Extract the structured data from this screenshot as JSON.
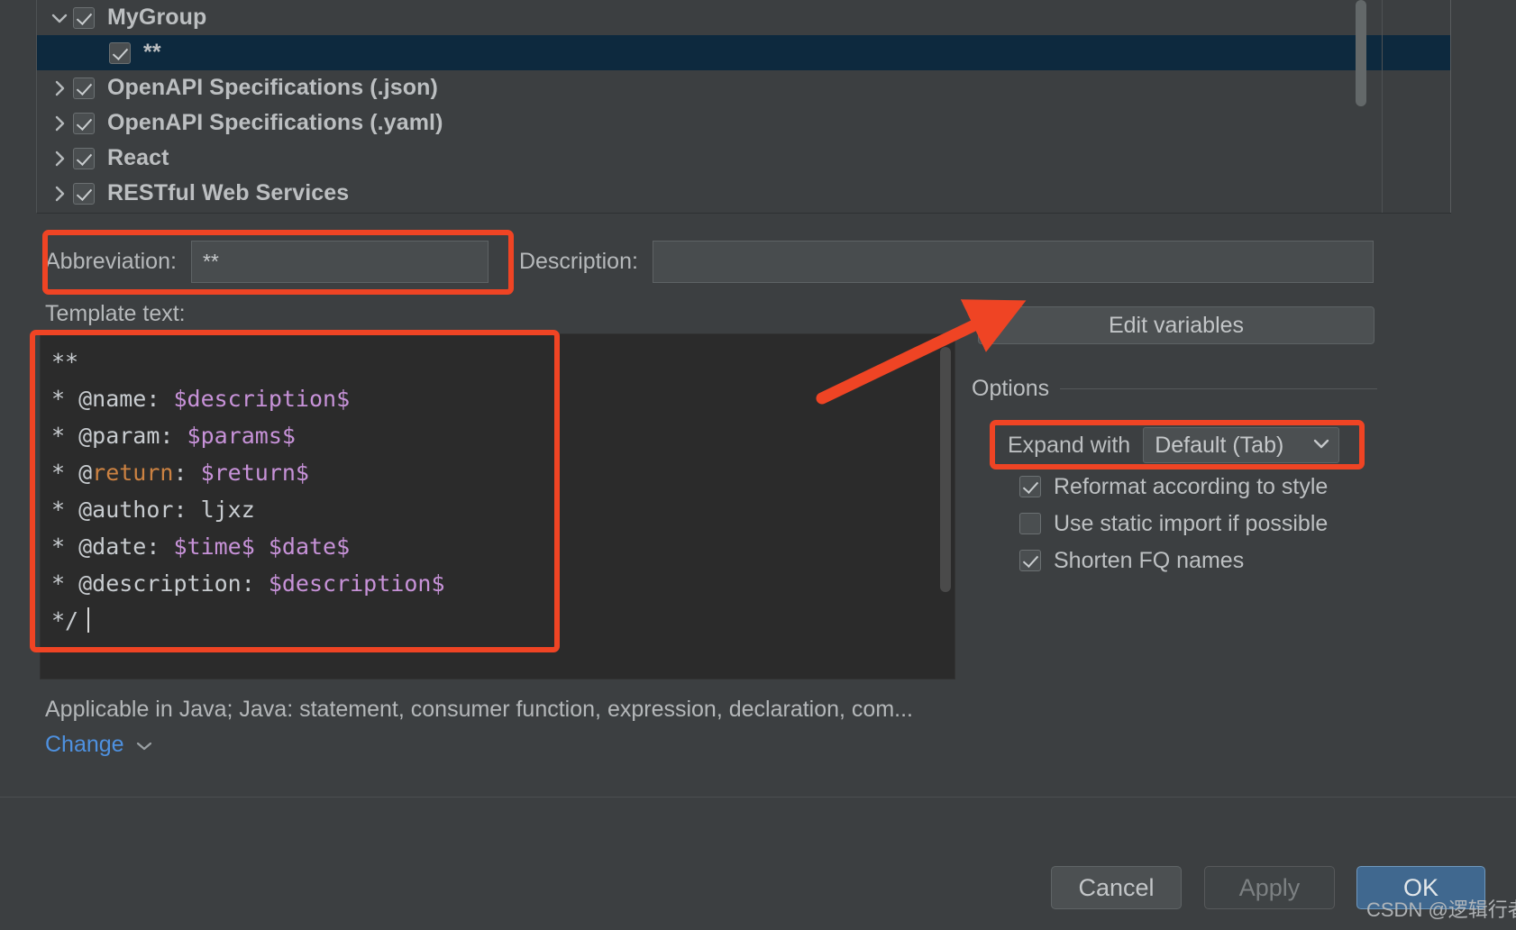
{
  "tree": {
    "items": [
      {
        "label": "MyGroup",
        "checked": true,
        "twisty": "chevron-down-icon",
        "level": 0,
        "selected": false
      },
      {
        "label": "**",
        "checked": true,
        "twisty": "none",
        "level": 1,
        "selected": true
      },
      {
        "label": "OpenAPI Specifications (.json)",
        "checked": true,
        "twisty": "chevron-right-icon",
        "level": 0,
        "selected": false
      },
      {
        "label": "OpenAPI Specifications (.yaml)",
        "checked": true,
        "twisty": "chevron-right-icon",
        "level": 0,
        "selected": false
      },
      {
        "label": "React",
        "checked": true,
        "twisty": "chevron-right-icon",
        "level": 0,
        "selected": false
      },
      {
        "label": "RESTful Web Services",
        "checked": true,
        "twisty": "chevron-right-icon",
        "level": 0,
        "selected": false
      }
    ]
  },
  "form": {
    "abbreviation_label": "Abbreviation:",
    "abbreviation_value": "**",
    "description_label": "Description:",
    "description_value": "",
    "description_placeholder": "",
    "template_text_label": "Template text:"
  },
  "template_code": {
    "lines": [
      [
        {
          "t": "**",
          "c": "plain"
        }
      ],
      [
        {
          "t": "* @name: ",
          "c": "plain"
        },
        {
          "t": "$description$",
          "c": "var"
        }
      ],
      [
        {
          "t": "* @param: ",
          "c": "plain"
        },
        {
          "t": "$params$",
          "c": "var"
        }
      ],
      [
        {
          "t": "* @",
          "c": "plain"
        },
        {
          "t": "return",
          "c": "kw"
        },
        {
          "t": ": ",
          "c": "plain"
        },
        {
          "t": "$return$",
          "c": "var"
        }
      ],
      [
        {
          "t": "* @author: ljxz",
          "c": "plain"
        }
      ],
      [
        {
          "t": "* @date: ",
          "c": "plain"
        },
        {
          "t": "$time$",
          "c": "var"
        },
        {
          "t": " ",
          "c": "plain"
        },
        {
          "t": "$date$",
          "c": "var"
        }
      ],
      [
        {
          "t": "* @description: ",
          "c": "plain"
        },
        {
          "t": "$description$",
          "c": "var"
        }
      ],
      [
        {
          "t": "*/",
          "c": "plain"
        },
        {
          "t": "",
          "c": "caret"
        }
      ]
    ]
  },
  "options": {
    "edit_variables_label": "Edit variables",
    "section_title": "Options",
    "expand_with_label": "Expand with",
    "expand_with_value": "Default (Tab)",
    "checkboxes": [
      {
        "label": "Reformat according to style",
        "checked": true
      },
      {
        "label": "Use static import if possible",
        "checked": false
      },
      {
        "label": "Shorten FQ names",
        "checked": true
      }
    ]
  },
  "footer": {
    "applicable_text": "Applicable in Java; Java: statement, consumer function, expression, declaration, com...",
    "change_label": "Change"
  },
  "buttons": {
    "cancel": "Cancel",
    "apply": "Apply",
    "ok": "OK"
  },
  "watermark": "CSDN @逻辑行者",
  "colors": {
    "accent_highlight": "#ef4424",
    "ok_button": "#40688f",
    "link": "#4e91e0",
    "variable": "#c792d8",
    "keyword": "#cc8242",
    "selection": "#0d293e"
  }
}
